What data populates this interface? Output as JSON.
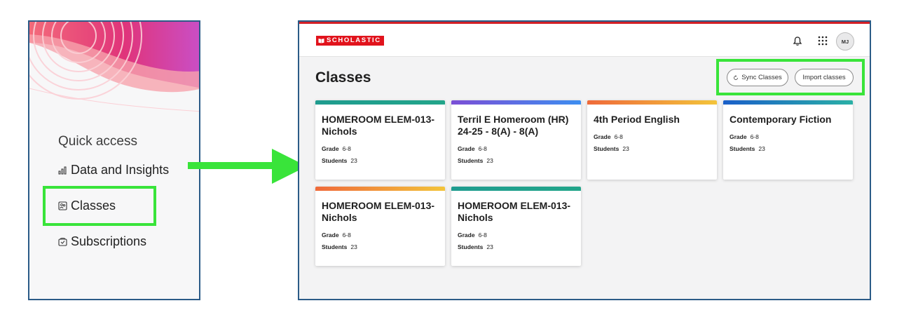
{
  "quick_access": {
    "heading": "Quick access",
    "items": [
      {
        "label": "Data and Insights",
        "icon": "bar-chart-icon"
      },
      {
        "label": "Classes",
        "icon": "classes-icon"
      },
      {
        "label": "Subscriptions",
        "icon": "subscriptions-icon"
      }
    ]
  },
  "header": {
    "brand": "SCHOLASTIC",
    "avatar_initials": "MJ",
    "icons": [
      "bell-icon",
      "app-grid-icon"
    ]
  },
  "page": {
    "title": "Classes",
    "sync_label": "Sync Classes",
    "import_label": "Import classes"
  },
  "cards": [
    {
      "title": "HOMEROOM ELEM-013-Nichols",
      "grade_label": "Grade",
      "grade": "6-8",
      "students_label": "Students",
      "students": "23",
      "bar_color": "#1f9c8f"
    },
    {
      "title": "Terril E Homeroom (HR) 24-25 - 8(A) - 8(A)",
      "grade_label": "Grade",
      "grade": "6-8",
      "students_label": "Students",
      "students": "23",
      "bar_color": "#5b6de0"
    },
    {
      "title": "4th Period English",
      "grade_label": "Grade",
      "grade": "6-8",
      "students_label": "Students",
      "students": "23",
      "bar_color": "#f08a2c"
    },
    {
      "title": "Contemporary Fiction",
      "grade_label": "Grade",
      "grade": "6-8",
      "students_label": "Students",
      "students": "23",
      "bar_color": "#1d6fd1"
    },
    {
      "title": "HOMEROOM ELEM-013-Nichols",
      "grade_label": "Grade",
      "grade": "6-8",
      "students_label": "Students",
      "students": "23",
      "bar_color": "#f07b3a"
    },
    {
      "title": "HOMEROOM ELEM-013-Nichols",
      "grade_label": "Grade",
      "grade": "6-8",
      "students_label": "Students",
      "students": "23",
      "bar_color": "#1f9c8f"
    }
  ],
  "colors": {
    "highlight": "#39e43a",
    "brand_red": "#e1131c",
    "frame": "#2b5b87"
  }
}
